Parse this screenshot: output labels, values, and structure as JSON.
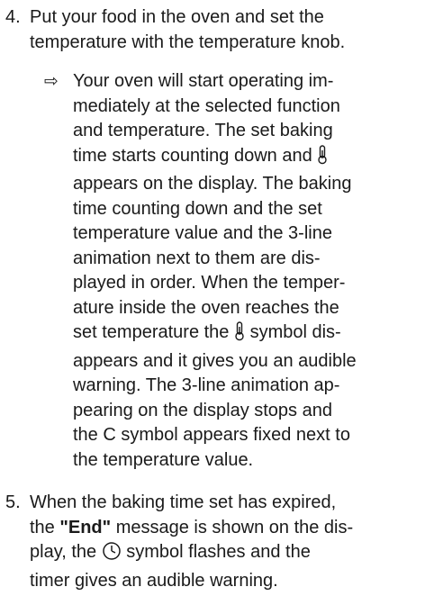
{
  "step4": {
    "number": "4.",
    "lines": [
      "Put your food in the oven and set the",
      "temperature with the temperature knob."
    ]
  },
  "result": {
    "arrow": "⇨",
    "lines": [
      "Your oven will start operating im-",
      "mediately at the selected function",
      "and temperature. The set baking",
      "time starts counting down and",
      "appears on the display. The baking",
      "time counting down and the set",
      "temperature value and the 3-line",
      "animation next to them are dis-",
      "played in order. When the temper-",
      "ature inside the oven reaches the",
      "set temperature the",
      "symbol dis-",
      "appears and it gives you an audible",
      "warning. The 3-line animation ap-",
      "pearing on the display stops and",
      "the C symbol appears fixed next to",
      "the temperature value."
    ]
  },
  "step5": {
    "number": "5.",
    "line1": "When the baking time set has expired,",
    "line2_pre": "the",
    "end_label": "\"End\"",
    "line2_post": "message is shown on the dis-",
    "line3_pre": "play, the",
    "line3_post": "symbol flashes and the",
    "line4": "timer gives an audible warning."
  }
}
